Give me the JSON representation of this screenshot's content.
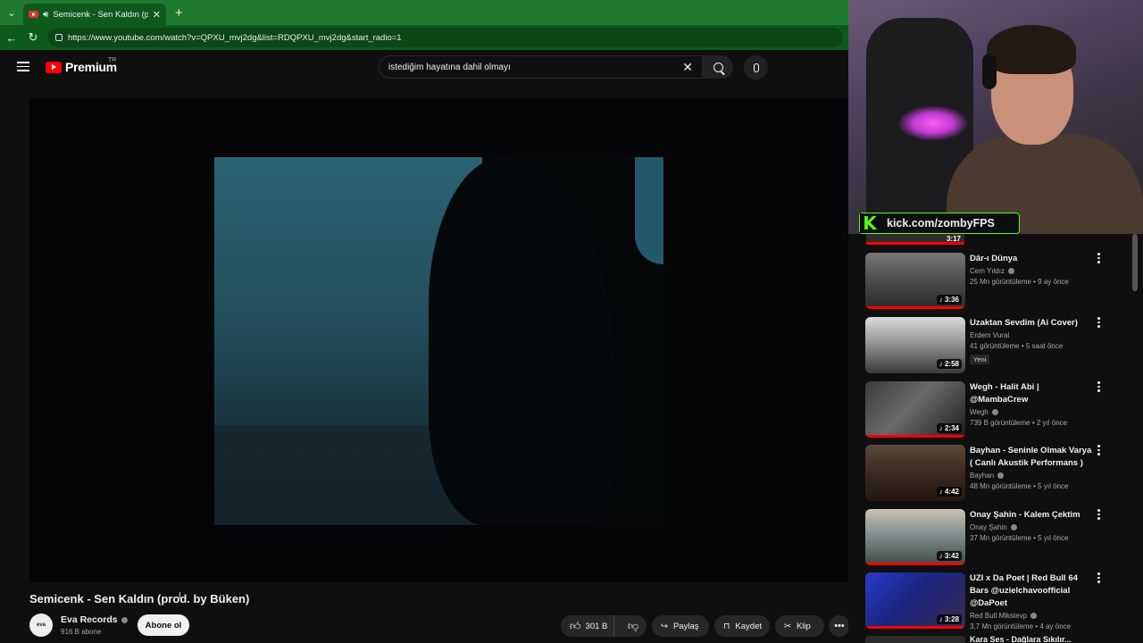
{
  "browser": {
    "tab_title": "Semicenk - Sen Kaldın (prod.",
    "url": "https://www.youtube.com/watch?v=QPXU_mvj2dg&list=RDQPXU_mvj2dg&start_radio=1"
  },
  "header": {
    "logo_text": "Premium",
    "region": "TR",
    "search_value": "istediğim hayatına dahil olmayı"
  },
  "video": {
    "title": "Semicenk - Sen Kaldın (prod. by Büken)",
    "channel": "Eva Records",
    "avatar_text": "eva",
    "subscribers": "916 B abone",
    "subscribe_label": "Abone ol",
    "likes": "301 B",
    "share_label": "Paylaş",
    "save_label": "Kaydet",
    "clip_label": "Klip"
  },
  "stream_overlay": {
    "kick_url": "kick.com/zombyFPS"
  },
  "sidebar": {
    "top_partial_duration": "3:17",
    "items": [
      {
        "title": "Dâr-ı Dünya",
        "channel": "Cem Yıldız",
        "stats": "25 Mn görüntüleme • 9 ay önce",
        "duration": "3:36",
        "badge": ""
      },
      {
        "title": "Uzaktan Sevdim (Ai Cover)",
        "channel": "Erdem Vural",
        "stats": "41 görüntüleme • 5 saat önce",
        "duration": "2:58",
        "badge": "Yeni"
      },
      {
        "title": "Wegh - Halit Abi | @MambaCrew",
        "channel": "Wegh",
        "stats": "739 B görüntüleme • 2 yıl önce",
        "duration": "2:34",
        "badge": ""
      },
      {
        "title": "Bayhan - Seninle Olmak Varya ( Canlı Akustik Performans )",
        "channel": "Bayhan",
        "stats": "48 Mn görüntüleme • 5 yıl önce",
        "duration": "4:42",
        "badge": ""
      },
      {
        "title": "Onay Şahin - Kalem Çektim",
        "channel": "Onay Şahin",
        "stats": "37 Mn görüntüleme • 5 yıl önce",
        "duration": "3:42",
        "badge": ""
      },
      {
        "title": "UZI x Da Poet | Red Bull 64 Bars @uzielchavoofficial @DaPoet",
        "channel": "Red Bull Mikstevp",
        "stats": "3,7 Mn görüntüleme • 4 ay önce",
        "duration": "3:28",
        "badge": ""
      }
    ],
    "bottom_partial_title": "Kara Ses - Dağlara Sıkılır..."
  }
}
